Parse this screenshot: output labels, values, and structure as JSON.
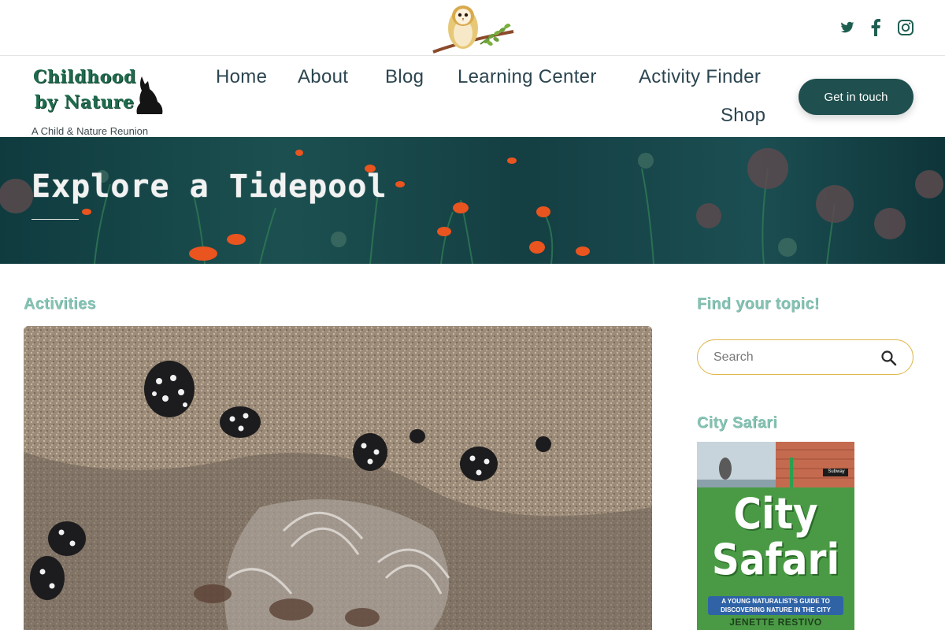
{
  "site": {
    "logo_line1": "Childhood",
    "logo_line2": "by Nature",
    "tagline": "A Child & Nature Reunion"
  },
  "social": [
    {
      "name": "twitter-icon"
    },
    {
      "name": "facebook-icon"
    },
    {
      "name": "instagram-icon"
    }
  ],
  "nav": {
    "home": "Home",
    "about": "About",
    "blog": "Blog",
    "learning_center": "Learning Center",
    "activity_finder": "Activity Finder",
    "shop": "Shop",
    "cta": "Get in touch"
  },
  "hero": {
    "title": "Explore a Tidepool"
  },
  "main": {
    "section_heading": "Activities"
  },
  "sidebar": {
    "find_heading": "Find your topic!",
    "search_placeholder": "Search",
    "book_heading": "City Safari",
    "book": {
      "title_line1": "City",
      "title_line2": "Safari",
      "subtitle_line1": "A YOUNG NATURALIST'S GUIDE TO",
      "subtitle_line2": "DISCOVERING NATURE IN THE CITY",
      "author": "JENETTE RESTIVO",
      "sign_text": "Subway"
    }
  },
  "colors": {
    "accent_green": "#1f4f4e",
    "heading_mint": "#86c3b4",
    "search_border": "#e0b64a"
  }
}
